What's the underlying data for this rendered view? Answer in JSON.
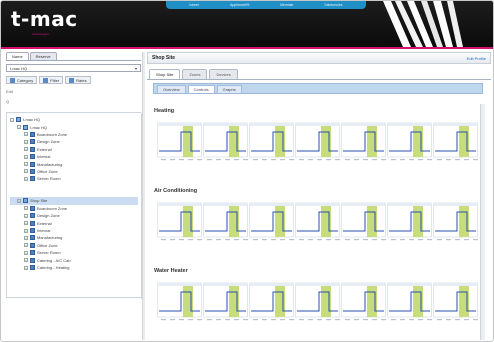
{
  "header": {
    "logo_text": "t-mac",
    "logo_subtext": "technologies",
    "nav_links": [
      "Ictmer",
      "Appliance99",
      "Memiaie",
      "Sabeuncies"
    ]
  },
  "left_panel": {
    "tabs": [
      "Name",
      "Reserve"
    ],
    "site_select": {
      "value": "t-mac HQ",
      "arrow": "chevron-down-icon"
    },
    "toolbar": [
      {
        "label": "Category",
        "icon": "category-icon"
      },
      {
        "label": "Filter",
        "icon": "filter-icon"
      },
      {
        "label": "Rates",
        "icon": "rates-icon"
      }
    ],
    "label_text": "Edit",
    "search_label": "Q",
    "tree": [
      {
        "label": "t-mac HQ",
        "level": 0,
        "exp": "−",
        "site": true
      },
      {
        "label": "t-mac HQ",
        "level": 1,
        "exp": "−",
        "site": true
      },
      {
        "label": "Boardroom Zone",
        "level": 2,
        "exp": "+"
      },
      {
        "label": "Design Zone",
        "level": 2,
        "exp": "+"
      },
      {
        "label": "External",
        "level": 2,
        "exp": "+"
      },
      {
        "label": "Internal",
        "level": 2,
        "exp": "+"
      },
      {
        "label": "Manufacturing",
        "level": 2,
        "exp": "+"
      },
      {
        "label": "Office Zone",
        "level": 2,
        "exp": "+"
      },
      {
        "label": "Server Room",
        "level": 2,
        "exp": "+"
      },
      {
        "label": "",
        "level": 0,
        "exp": ""
      },
      {
        "label": "",
        "level": 0,
        "exp": ""
      },
      {
        "label": "Shop Site",
        "level": 1,
        "exp": "−",
        "site": true,
        "selected": true
      },
      {
        "label": "Boardroom Zone",
        "level": 2,
        "exp": "+"
      },
      {
        "label": "Design Zone",
        "level": 2,
        "exp": "+"
      },
      {
        "label": "External",
        "level": 2,
        "exp": "+"
      },
      {
        "label": "Internal",
        "level": 2,
        "exp": "+"
      },
      {
        "label": "Manufacturing",
        "level": 2,
        "exp": "+"
      },
      {
        "label": "Office Zone",
        "level": 2,
        "exp": "+"
      },
      {
        "label": "Server Room",
        "level": 2,
        "exp": "+"
      },
      {
        "label": "Catering - A/C Cab",
        "level": 2,
        "exp": "+"
      },
      {
        "label": "Catering - Heating",
        "level": 2,
        "exp": "+"
      }
    ]
  },
  "right_panel": {
    "title": "Shop Site",
    "title_link": "Edit Profile",
    "tabs": [
      "Shop Site",
      "Zones",
      "Devices"
    ],
    "subtabs": [
      "Overview",
      "Controls",
      "Graphs"
    ],
    "sections": [
      {
        "title": "Heating"
      },
      {
        "title": "Air Conditioning"
      },
      {
        "title": "Water Heater"
      }
    ],
    "colors": {
      "band": "#c7dc7a",
      "line": "#2a4fb0",
      "grid": "#cfd8e3"
    }
  }
}
